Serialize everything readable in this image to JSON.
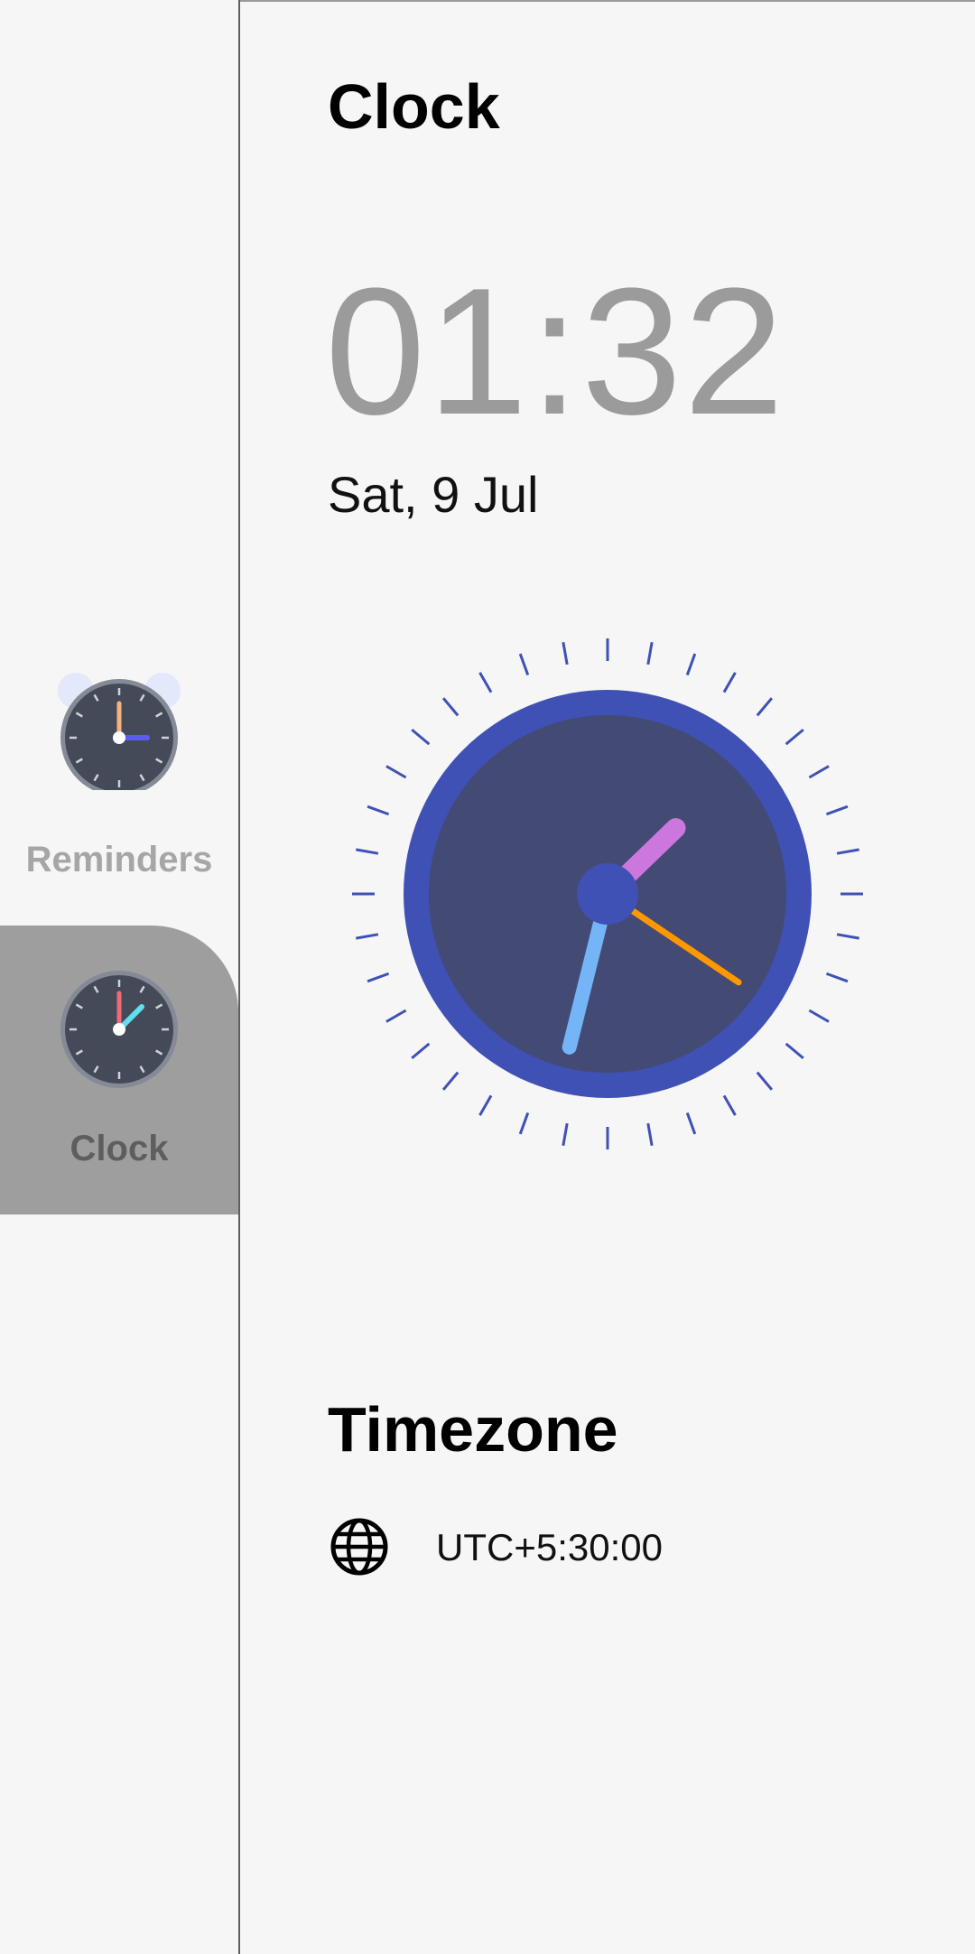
{
  "nav": {
    "items": [
      {
        "label": "Reminders",
        "icon": "alarm-clock-icon",
        "selected": false
      },
      {
        "label": "Clock",
        "icon": "clock-icon",
        "selected": true
      }
    ]
  },
  "clock_page": {
    "title": "Clock",
    "time": "01:32",
    "date": "Sat, 9 Jul",
    "analog": {
      "hour": 1,
      "minute": 32,
      "second": 20
    }
  },
  "timezone": {
    "title": "Timezone",
    "icon": "globe-icon",
    "value": "UTC+5:30:00"
  },
  "colors": {
    "accent": "#3f51b5",
    "clock_face": "#434a74",
    "hour_hand": "#cc77dd",
    "minute_hand": "#74b5f8",
    "second_hand": "#ff9800",
    "selected_nav_bg": "#9e9e9e"
  }
}
